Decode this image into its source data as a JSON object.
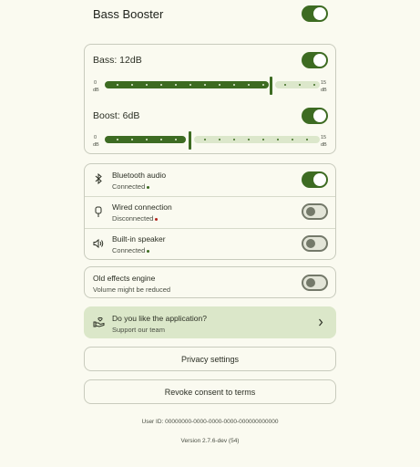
{
  "bass_booster": {
    "title": "Bass Booster",
    "enabled": true
  },
  "sliders": [
    {
      "label": "Bass: 12dB",
      "value_db": 12,
      "min_label": "0",
      "max_label": "15",
      "unit": "dB",
      "fraction": 0.8
    },
    {
      "label": "Boost: 6dB",
      "value_db": 6,
      "min_label": "0",
      "max_label": "15",
      "unit": "dB",
      "fraction": 0.4
    }
  ],
  "outputs": [
    {
      "label": "Bluetooth audio",
      "status": "Connected",
      "status_color": "#3d6b22",
      "icon": "bluetooth-icon",
      "enabled": true
    },
    {
      "label": "Wired connection",
      "status": "Disconnected",
      "status_color": "#b3261e",
      "icon": "wired-connection-icon",
      "enabled": false
    },
    {
      "label": "Built-in speaker",
      "status": "Connected",
      "status_color": "#3d6b22",
      "icon": "speaker-icon",
      "enabled": false
    }
  ],
  "old_engine": {
    "label": "Old effects engine",
    "sub": "Volume might be reduced",
    "enabled": false
  },
  "support": {
    "title": "Do you like the application?",
    "sub": "Support our team",
    "icon": "hand-heart-icon"
  },
  "buttons": {
    "privacy": "Privacy settings",
    "revoke": "Revoke consent to terms"
  },
  "footer": {
    "user_id": "User ID: 00000000-0000-0000-0000-000000000000",
    "version": "Version 2.7.6-dev (54)"
  },
  "colors": {
    "accent": "#3d6b22",
    "background": "#fafaf0",
    "track_light": "#dce7cb",
    "support_bg": "#dbe7c9"
  }
}
